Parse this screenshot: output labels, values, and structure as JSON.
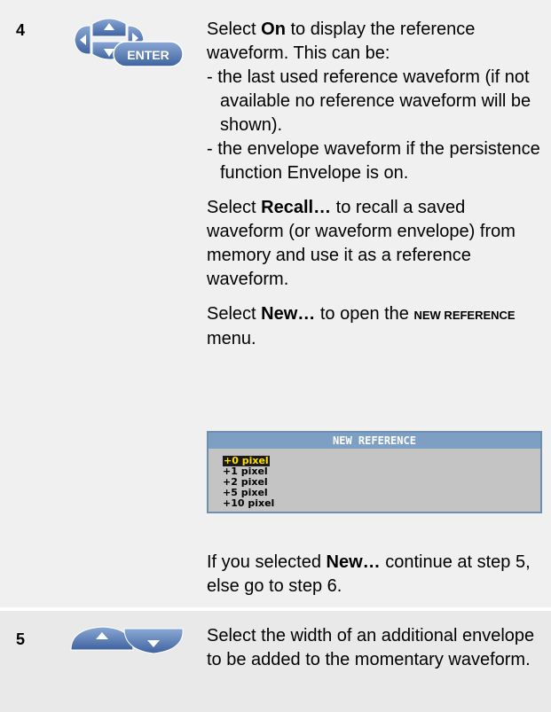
{
  "step4": {
    "number": "4",
    "button_label": "ENTER",
    "p1_a": "Select ",
    "p1_b": "On",
    "p1_c": " to display the reference waveform.  This can be:",
    "bullets": [
      "- the last used reference waveform (if not available no reference waveform will be shown).",
      "- the envelope waveform if the persistence function Envelope is on."
    ],
    "p2_a": "Select ",
    "p2_b": "Recall…",
    "p2_c": " to recall a saved waveform (or waveform envelope) from memory and use it as a reference waveform.",
    "p3_a": "Select ",
    "p3_b": "New…",
    "p3_c": " to open the ",
    "p3_d": "NEW REFERENCE",
    "p3_e": " menu.",
    "menu": {
      "title": "NEW REFERENCE",
      "items": [
        "+0 pixel",
        "+1 pixel",
        "+2 pixel",
        "+5 pixel",
        "+10 pixel"
      ]
    },
    "p4_a": "If you selected ",
    "p4_b": "New…",
    "p4_c": " continue at step 5, else go to step 6."
  },
  "step5": {
    "number": "5",
    "text": "Select the width of an additional envelope to be added to the momentary waveform."
  },
  "colors": {
    "row_bg": "#f0f0f0",
    "button_blue": "#5a7fb8",
    "menu_title_bg": "#7e9fc4",
    "menu_selected": "#ffe000"
  }
}
